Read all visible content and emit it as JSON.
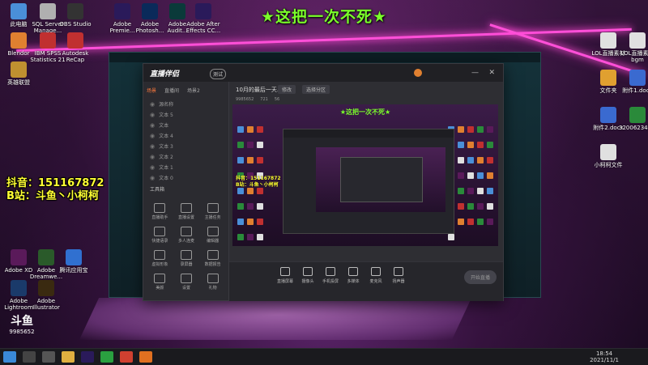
{
  "headline": "★这把一次不死★",
  "overlay": {
    "line1": "抖音：151167872",
    "line2": "B站：斗鱼丶小柯柯"
  },
  "desktop_left": [
    {
      "label": "此电脑",
      "color": "#4a8fd8"
    },
    {
      "label": "SQL Server Manage...",
      "color": "#b0b0b0"
    },
    {
      "label": "OBS Studio",
      "color": "#333"
    },
    {
      "label": "Adobe Premie...",
      "color": "#2a1a5a"
    },
    {
      "label": "Adobe Photosh...",
      "color": "#0a2a5a"
    },
    {
      "label": "Adobe Audit...",
      "color": "#0a3a3a"
    },
    {
      "label": "Adobe After Effects CC...",
      "color": "#2a1a5a"
    },
    {
      "label": "Blendor",
      "color": "#e08030"
    },
    {
      "label": "IBM SPSS Statistics 21",
      "color": "#c03030"
    },
    {
      "label": "Autodesk ReCap",
      "color": "#c03030"
    },
    {
      "label": "英雄联盟",
      "color": "#c09030"
    },
    {
      "label": "Adobe Lightroom",
      "color": "#1a3a6a"
    },
    {
      "label": "Adobe Illustrator",
      "color": "#3a2a10"
    }
  ],
  "bottom_desktop": [
    {
      "label": "Adobe XD",
      "color": "#5a1a5a"
    },
    {
      "label": "Adobe Dreamwe...",
      "color": "#2a5a2a"
    },
    {
      "label": "腾讯应用宝",
      "color": "#3070d0"
    }
  ],
  "watermark": {
    "line1": "斗鱼",
    "line2": "9985652"
  },
  "clock": {
    "time": "18:54",
    "date": "2021/11/1"
  },
  "app": {
    "name": "直播伴侣",
    "badge": "测试",
    "stream_title": "10月的最后一天...",
    "edit_btn": "修改",
    "status_btn": "选择分区",
    "room_id": "9985652",
    "viewers": "721",
    "fans": "56",
    "tabs": [
      "场景",
      "直播间",
      "场景2"
    ],
    "sources": [
      "源名称",
      "文本 5",
      "文本",
      "文本 4",
      "文本 3",
      "文本 2",
      "文本 1",
      "文本 0"
    ],
    "tools_title": "工具箱",
    "tools": [
      "直播助手",
      "直播设置",
      "主播任务",
      "快捷语录",
      "多人连麦",
      "编辑器",
      "虚拟形象",
      "录屏器",
      "数据报告",
      "美颜",
      "设置",
      "礼物"
    ],
    "bottom_items": [
      "直播屏幕",
      "摄像头",
      "手机投屏",
      "多媒体",
      "麦克风",
      "扬声器"
    ],
    "start_label": "开始直播",
    "preview_headline": "★这把一次不死★",
    "mini_overlay1": "抖音：151167872",
    "mini_overlay2": "B站：斗鱼丶小柯柯"
  },
  "right_icons": [
    {
      "label": "LOL直播素材",
      "color": "#e0e0e0"
    },
    {
      "label": "LOL直播素材bgm",
      "color": "#e0e0e0"
    },
    {
      "label": "文件夹",
      "color": "#e0a030"
    },
    {
      "label": "附件1.docx",
      "color": "#3a6ad0"
    },
    {
      "label": "附件2.docx",
      "color": "#3a6ad0"
    },
    {
      "label": "32006234.xlsx",
      "color": "#2a8a3a"
    },
    {
      "label": "小柯柯文件",
      "color": "#e0e0e0"
    }
  ]
}
